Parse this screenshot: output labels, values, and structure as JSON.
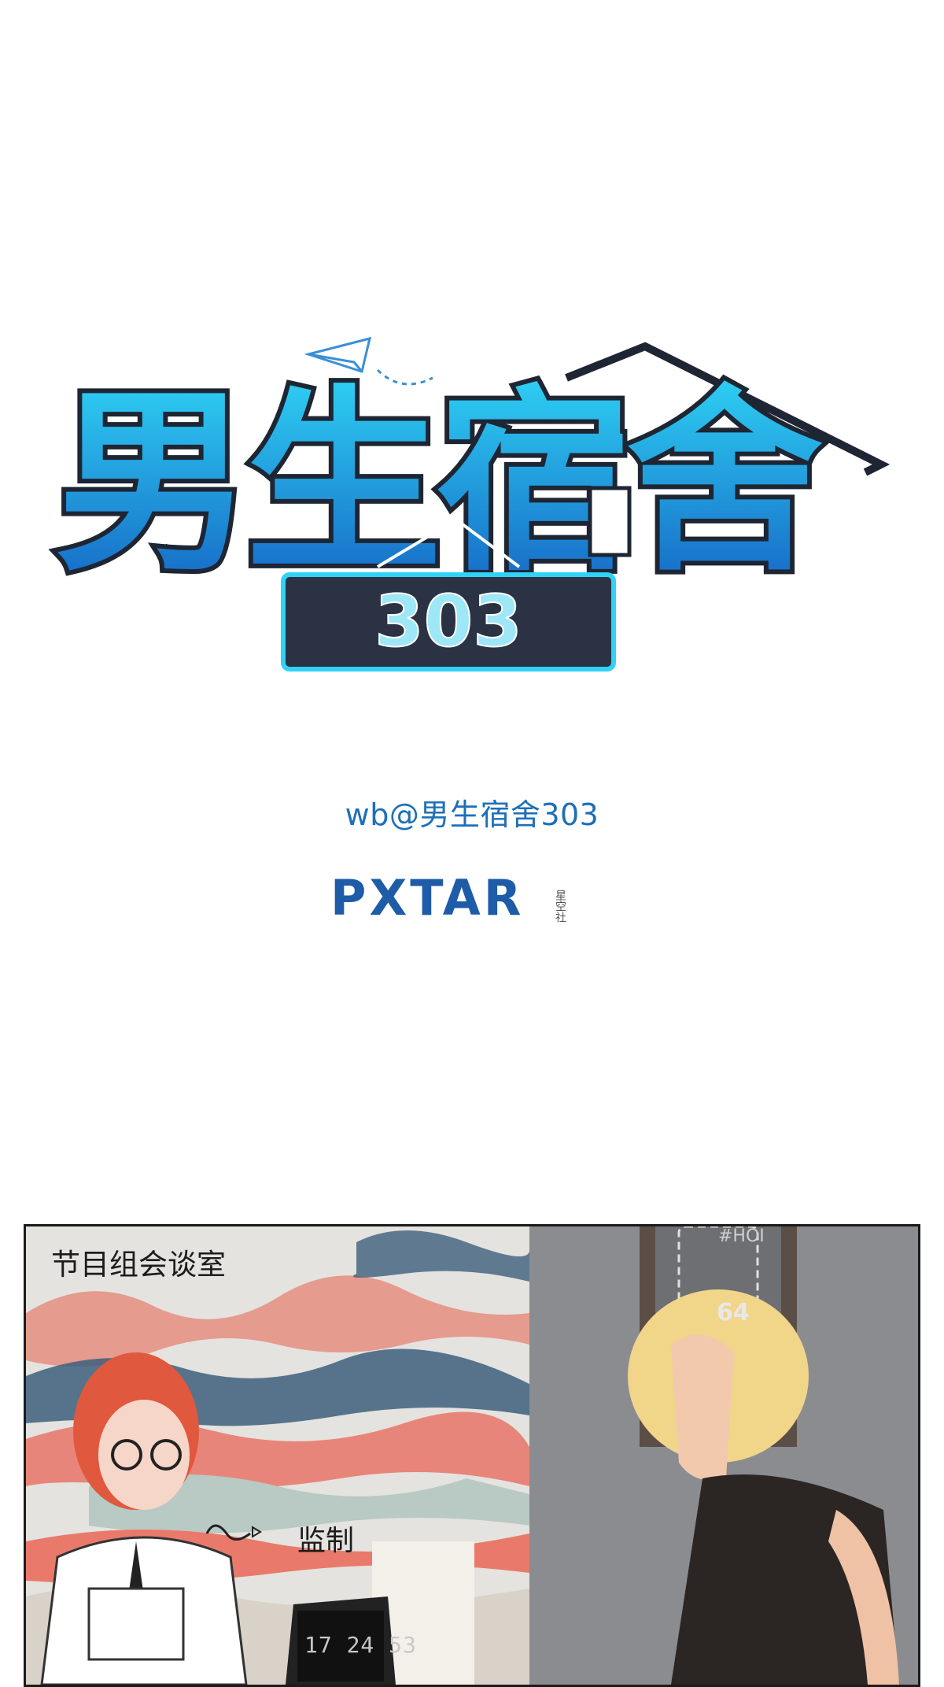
{
  "logo": {
    "title": "男生宿舍",
    "number": "303"
  },
  "credit": "wb@男生宿舍303",
  "publisher": {
    "name": "PXTAR",
    "sub": "星空社"
  },
  "panel": {
    "caption": "节目组会谈室",
    "tag": "监制",
    "clock": "17 24 53",
    "door_top": "#HOI",
    "door_number": "64"
  },
  "colors": {
    "logo_blue": "#1a73c9",
    "logo_cyan": "#2fd3f5",
    "logo_dark": "#2b3244",
    "credit_blue": "#1e6fb8"
  }
}
